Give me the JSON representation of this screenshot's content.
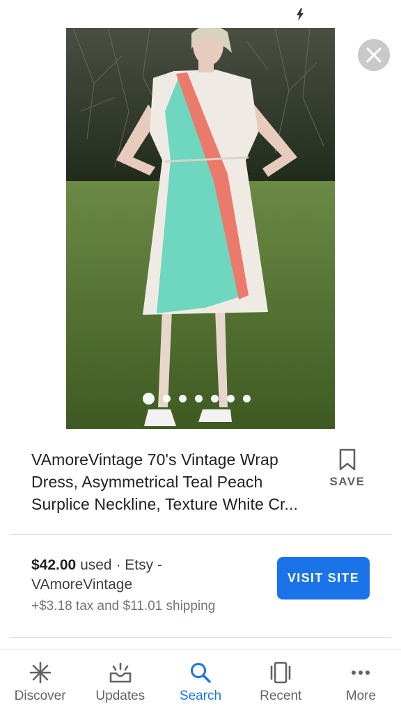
{
  "listing": {
    "title_lines": [
      "VAmoreVintage 70's Vintage Wrap",
      "Dress, Asymmetrical Teal Peach",
      "Surplice Neckline, Texture White Cr..."
    ],
    "save_label": "SAVE",
    "price": "$42.00",
    "condition_and_store": " used · Etsy -",
    "seller": "VAmoreVintage",
    "tax_shipping": "+$3.18 tax and $11.01 shipping",
    "visit_label": "VISIT SITE"
  },
  "carousel": {
    "count": 7,
    "active_index": 0
  },
  "nav": {
    "items": [
      {
        "label": "Discover",
        "icon": "asterisk-icon"
      },
      {
        "label": "Updates",
        "icon": "updates-tray-icon"
      },
      {
        "label": "Search",
        "icon": "search-icon"
      },
      {
        "label": "Recent",
        "icon": "recent-cards-icon"
      },
      {
        "label": "More",
        "icon": "more-dots-icon"
      }
    ],
    "active_index": 2
  },
  "colors": {
    "accent": "#1a73e8",
    "dress_teal": "#6fd6bf",
    "dress_peach": "#ec7a6a",
    "dress_white": "#efebe4"
  }
}
